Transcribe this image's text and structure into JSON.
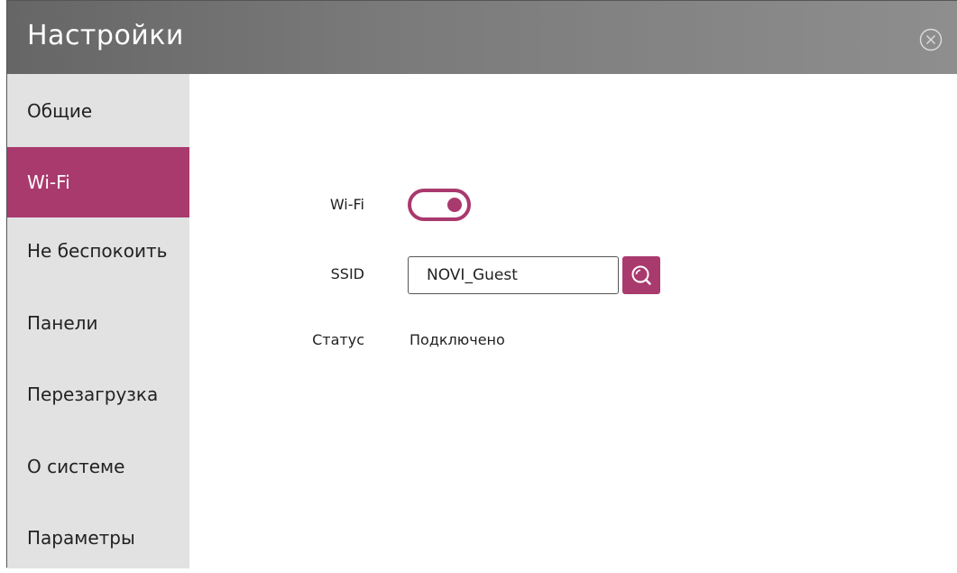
{
  "window": {
    "title": "Настройки",
    "close_icon": "close-circle-icon"
  },
  "sidebar": {
    "items": [
      {
        "label": "Общие",
        "active": false
      },
      {
        "label": "Wi-Fi",
        "active": true
      },
      {
        "label": "Не беспокоить",
        "active": false
      },
      {
        "label": "Панели",
        "active": false
      },
      {
        "label": "Перезагрузка",
        "active": false
      },
      {
        "label": "О системе",
        "active": false
      },
      {
        "label": "Параметры",
        "active": false
      }
    ]
  },
  "wifi": {
    "toggle_label": "Wi-Fi",
    "toggle_on": true,
    "ssid_label": "SSID",
    "ssid_value": "NOVI_Guest",
    "search_icon": "search-icon",
    "status_label": "Статус",
    "status_value": "Подключено"
  },
  "colors": {
    "accent": "#a93a6e",
    "sidebar_bg": "#e2e2e2",
    "titlebar_bg": "#7a7a7a",
    "text": "#222222"
  }
}
